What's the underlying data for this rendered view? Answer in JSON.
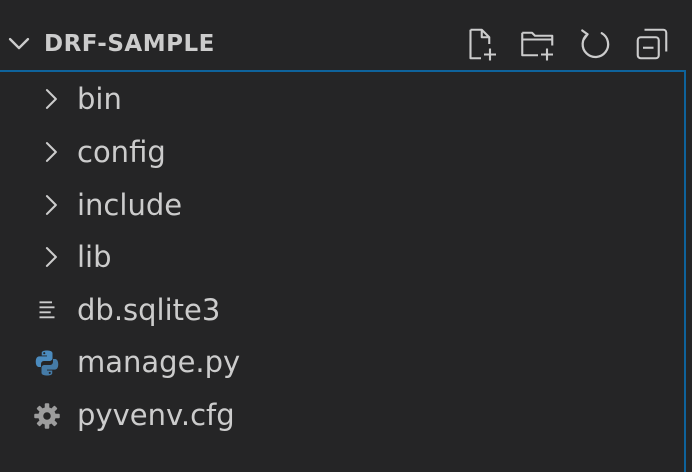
{
  "explorer": {
    "title": "DRF-SAMPLE",
    "actions": [
      {
        "name": "new-file",
        "icon": "new-file-icon"
      },
      {
        "name": "new-folder",
        "icon": "new-folder-icon"
      },
      {
        "name": "refresh",
        "icon": "refresh-icon"
      },
      {
        "name": "collapse-all",
        "icon": "collapse-all-icon"
      }
    ],
    "items": [
      {
        "label": "bin",
        "kind": "folder",
        "icon": "chevron-right-icon"
      },
      {
        "label": "config",
        "kind": "folder",
        "icon": "chevron-right-icon"
      },
      {
        "label": "include",
        "kind": "folder",
        "icon": "chevron-right-icon"
      },
      {
        "label": "lib",
        "kind": "folder",
        "icon": "chevron-right-icon"
      },
      {
        "label": "db.sqlite3",
        "kind": "file",
        "icon": "text-file-icon"
      },
      {
        "label": "manage.py",
        "kind": "file",
        "icon": "python-icon"
      },
      {
        "label": "pyvenv.cfg",
        "kind": "file",
        "icon": "gear-icon"
      }
    ]
  },
  "colors": {
    "background": "#252526",
    "text": "#cccccc",
    "focus_border": "#0e639c",
    "python_blue": "#4b8bbe",
    "python_yellow": "#ffd43b",
    "icon_gray": "#9d9d9d"
  }
}
